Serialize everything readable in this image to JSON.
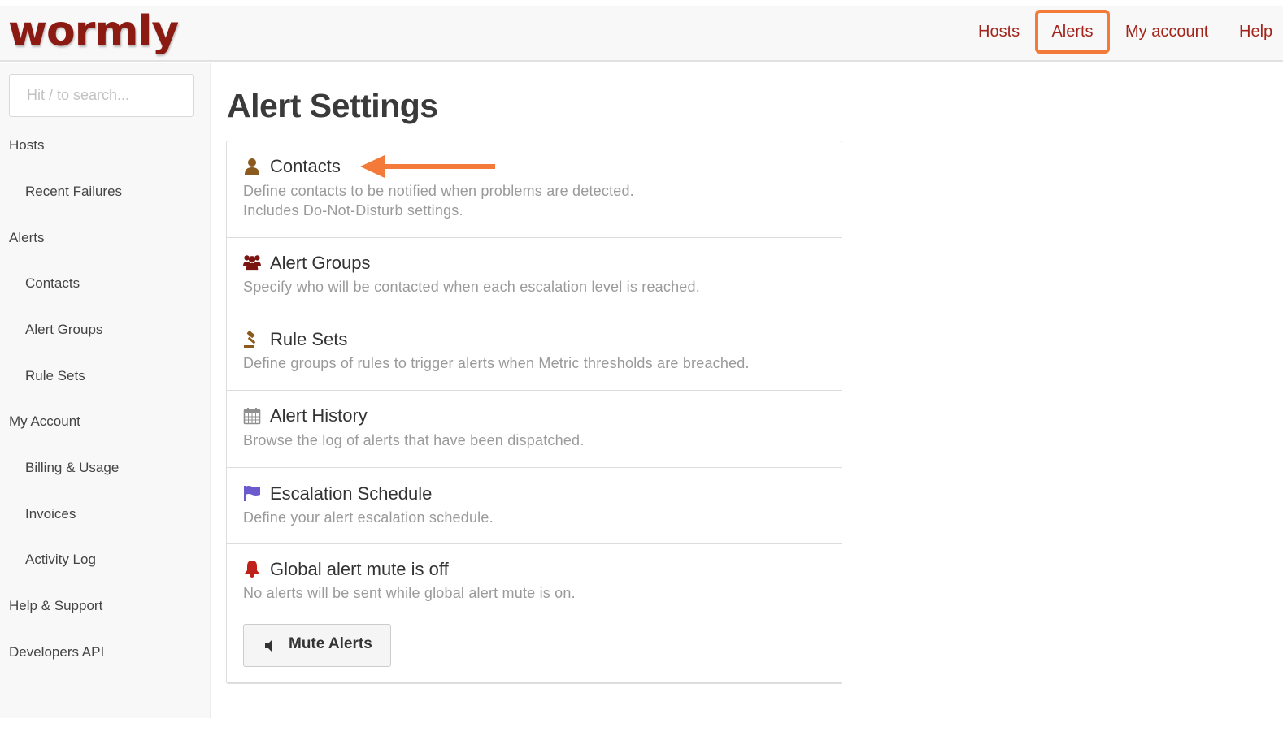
{
  "header": {
    "logo_text": "wormly",
    "nav": {
      "hosts": "Hosts",
      "alerts": "Alerts",
      "my_account": "My account",
      "help": "Help"
    }
  },
  "sidebar": {
    "search_placeholder": "Hit / to search...",
    "items": [
      {
        "label": "Hosts",
        "level": 1
      },
      {
        "label": "Recent Failures",
        "level": 2
      },
      {
        "label": "Alerts",
        "level": 1
      },
      {
        "label": "Contacts",
        "level": 2
      },
      {
        "label": "Alert Groups",
        "level": 2
      },
      {
        "label": "Rule Sets",
        "level": 2
      },
      {
        "label": "My Account",
        "level": 1
      },
      {
        "label": "Billing & Usage",
        "level": 2
      },
      {
        "label": "Invoices",
        "level": 2
      },
      {
        "label": "Activity Log",
        "level": 2
      },
      {
        "label": "Help & Support",
        "level": 1
      },
      {
        "label": "Developers API",
        "level": 1
      }
    ]
  },
  "main": {
    "title": "Alert Settings",
    "rows": [
      {
        "icon": "user-icon",
        "title": "Contacts",
        "desc": [
          "Define contacts to be notified when problems are detected.",
          "Includes Do-Not-Disturb settings."
        ]
      },
      {
        "icon": "users-icon",
        "title": "Alert Groups",
        "desc": [
          "Specify who will be contacted when each escalation level is reached."
        ]
      },
      {
        "icon": "gavel-icon",
        "title": "Rule Sets",
        "desc": [
          "Define groups of rules to trigger alerts when Metric thresholds are breached."
        ]
      },
      {
        "icon": "calendar-icon",
        "title": "Alert History",
        "desc": [
          "Browse the log of alerts that have been dispatched."
        ]
      },
      {
        "icon": "flag-icon",
        "title": "Escalation Schedule",
        "desc": [
          "Define your alert escalation schedule."
        ]
      },
      {
        "icon": "bell-icon",
        "title": "Global alert mute is off",
        "desc": [
          "No alerts will be sent while global alert mute is on."
        ]
      }
    ],
    "mute_button": {
      "label": "Mute Alerts",
      "icon": "volume-off-icon"
    }
  },
  "colors": {
    "brand": "#8b1a12",
    "nav_link": "#a3241b",
    "highlight": "#f47a3a",
    "muted_text": "#9a9a9a",
    "flag": "#6a5acd",
    "bell": "#c0201a",
    "user": "#8a5a1e"
  }
}
